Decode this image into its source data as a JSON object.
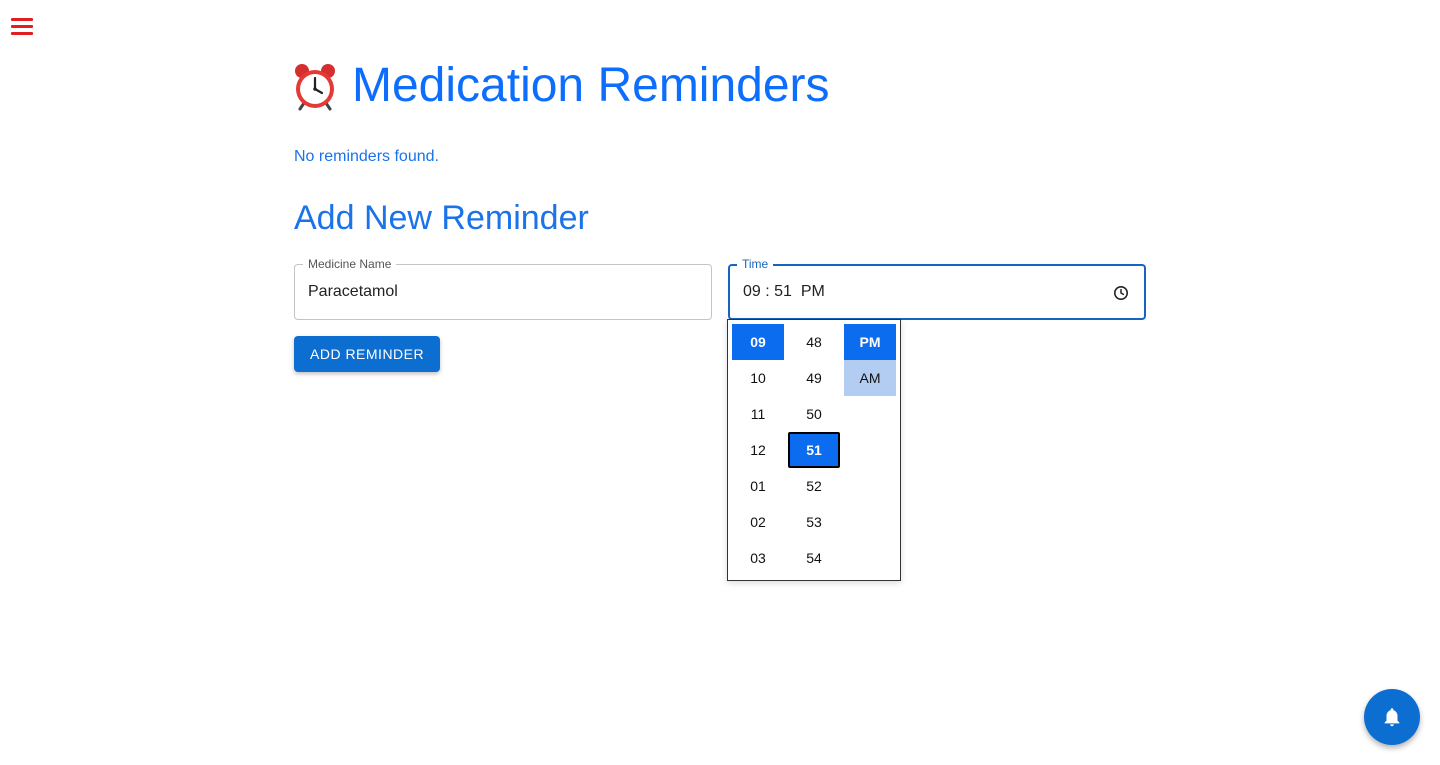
{
  "header": {
    "title": "Medication Reminders",
    "title_icon": "alarm-clock-icon"
  },
  "reminders": {
    "empty_message": "No reminders found."
  },
  "form": {
    "section_title": "Add New Reminder",
    "medicine_name": {
      "label": "Medicine Name",
      "value": "Paracetamol"
    },
    "time": {
      "label": "Time",
      "value": "09 : 51  PM"
    },
    "submit_label": "ADD REMINDER"
  },
  "time_picker": {
    "hours": [
      "09",
      "10",
      "11",
      "12",
      "01",
      "02",
      "03"
    ],
    "minutes": [
      "48",
      "49",
      "50",
      "51",
      "52",
      "53",
      "54"
    ],
    "periods": [
      "PM",
      "AM"
    ],
    "selected_hour": "09",
    "selected_minute": "51",
    "selected_period": "PM",
    "hovered_period": "AM"
  },
  "colors": {
    "accent": "#0d6efd",
    "menu": "#e02020",
    "selected_option": "#0b6cf0",
    "hover_option": "#b3cdf2"
  },
  "icons": {
    "menu": "hamburger-menu-icon",
    "time_field": "clock-icon",
    "fab": "bell-icon"
  }
}
